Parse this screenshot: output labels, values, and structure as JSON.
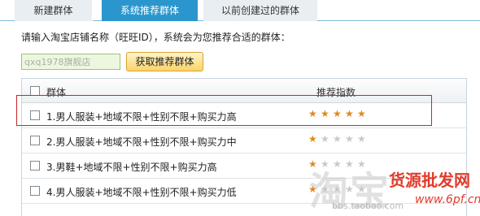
{
  "tabs": [
    {
      "label": "新建群体",
      "active": false
    },
    {
      "label": "系统推荐群体",
      "active": true
    },
    {
      "label": "以前创建过的群体",
      "active": false
    }
  ],
  "prompt": "请输入淘宝店铺名称（旺旺ID），系统会为您推荐合适的群体：",
  "shop_input": {
    "value": "",
    "placeholder": "qxq1978旗舰店"
  },
  "get_button_label": "获取推荐群体",
  "table": {
    "headers": {
      "group": "群体",
      "index": "推荐指数"
    },
    "rows": [
      {
        "label": "1.男人服装+地域不限+性别不限+购买力高",
        "rating": 5,
        "checked": false
      },
      {
        "label": "2.男人服装+地域不限+性别不限+购买力中",
        "rating": 1,
        "checked": false
      },
      {
        "label": "3.男鞋+地域不限+性别不限+购买力高",
        "rating": 1,
        "checked": false
      },
      {
        "label": "4.男人服装+地域不限+性别不限+购买力低",
        "rating": 1,
        "checked": false
      }
    ]
  },
  "colors": {
    "active_tab": "#2a96cd",
    "star_on": "#e0891a",
    "star_off": "#c9c9c9",
    "highlight_box": "#c4282a"
  },
  "watermark": {
    "big": "淘宝",
    "url": "bbs.taobao.com",
    "site": "货源批发网",
    "site_url": "www.6pf.cn"
  }
}
